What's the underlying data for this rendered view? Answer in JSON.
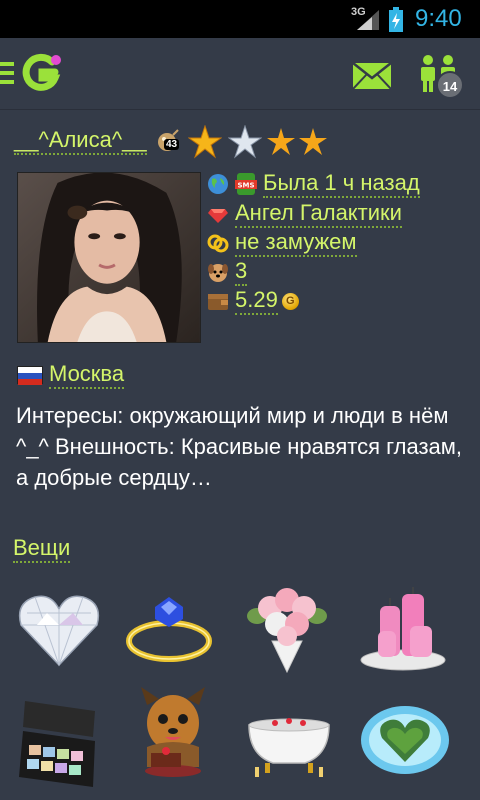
{
  "status_bar": {
    "network": "3G",
    "time": "9:40"
  },
  "header": {
    "friends_badge": "14"
  },
  "profile": {
    "username": "__^Алиса^__",
    "bomb_count": "43",
    "last_seen": "Была 1 ч назад",
    "status": "Ангел Галактики",
    "relationship": "не замужем",
    "pets": "3",
    "balance": "5.29",
    "city": "Москва",
    "about": "Интересы: окружающий мир и люди в нём ^_^ Внешность: Красивые нравятся глазам, а добрые сердцу…"
  },
  "things": {
    "title": "Вещи",
    "items": [
      "diamond-heart",
      "sapphire-ring",
      "rose-bouquet",
      "pink-candles",
      "eyeshadow-palette",
      "yorkie-cake",
      "rose-bath",
      "heart-island"
    ]
  },
  "colors": {
    "background": "#343b48",
    "accent_green": "#9be13a",
    "link_text": "#d4f56a",
    "clock_blue": "#33b5e5"
  }
}
